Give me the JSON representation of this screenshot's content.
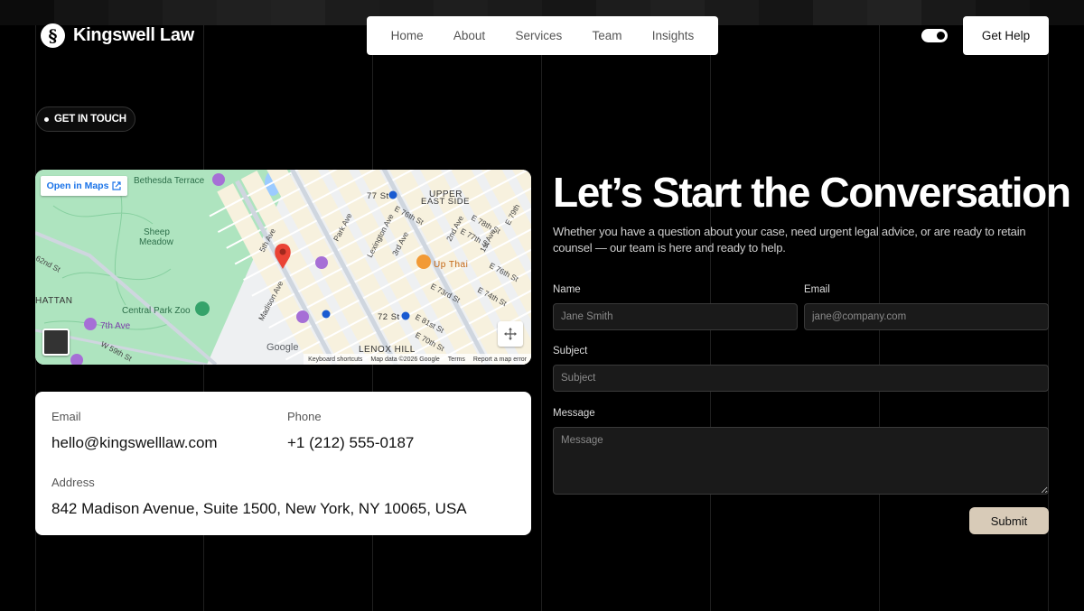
{
  "header": {
    "brand": "Kingswell Law",
    "brand_mark": "§",
    "nav": [
      "Home",
      "About",
      "Services",
      "Team",
      "Insights"
    ],
    "cta": "Get Help"
  },
  "badge": "GET IN TOUCH",
  "map": {
    "open_label": "Open in Maps",
    "labels": {
      "bethesda": "Bethesda Terrace",
      "sheep": "Sheep",
      "meadow": "Meadow",
      "zoo": "Central Park Zoo",
      "seventh": "7th Ave",
      "hattan": "HATTAN",
      "upper": "UPPER",
      "eastside": "EAST SIDE",
      "upthai": "Up Thai",
      "lenox": "LENOX HILL",
      "st77": "77 St",
      "st72": "72 St",
      "fifth": "5th Ave",
      "madison": "Madison Ave",
      "park": "Park Ave",
      "lex": "Lexington Ave",
      "third": "3rd Ave",
      "second": "2nd Ave",
      "first": "1st Ave",
      "w59": "W 59th St",
      "e76": "E 76th St",
      "e78": "E 78th St",
      "e77": "E 77th St",
      "e73": "E 73rd St",
      "e74": "E 74th St",
      "e81": "E 81st St",
      "e70": "E 70th St",
      "e79": "E 79th",
      "st62": "62nd St",
      "google": "Google"
    },
    "footer": [
      "Keyboard shortcuts",
      "Map data ©2026 Google",
      "Terms",
      "Report a map error"
    ]
  },
  "contact": {
    "email_label": "Email",
    "email": "hello@kingswelllaw.com",
    "phone_label": "Phone",
    "phone": "+1 (212) 555-0187",
    "address_label": "Address",
    "address": "842 Madison Avenue, Suite 1500, New York, NY 10065, USA"
  },
  "hero": {
    "title": "Let’s Start the Conversation",
    "subtitle": "Whether you have a question about your case, need urgent legal advice, or are ready to retain counsel — our team is here and ready to help."
  },
  "form": {
    "name_label": "Name",
    "name_placeholder": "Jane Smith",
    "email_label": "Email",
    "email_placeholder": "jane@company.com",
    "subject_label": "Subject",
    "subject_placeholder": "Subject",
    "message_label": "Message",
    "message_placeholder": "Message",
    "submit": "Submit"
  },
  "colors": {
    "background": "#000000",
    "submit": "#d8cbb8",
    "field": "#1a1a1a",
    "map_park": "#aee4bf",
    "map_pin": "#ea4335"
  }
}
